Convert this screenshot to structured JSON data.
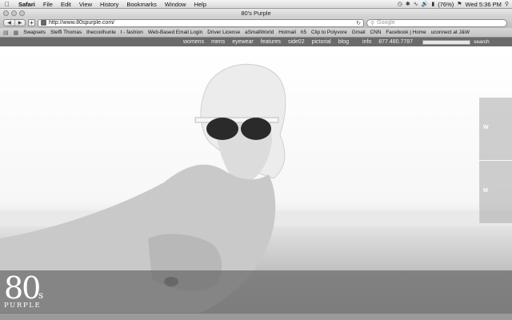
{
  "menubar": {
    "app": "Safari",
    "items": [
      "File",
      "Edit",
      "View",
      "History",
      "Bookmarks",
      "Window",
      "Help"
    ],
    "battery": "(76%)",
    "clock": "Wed 5:36 PM"
  },
  "window": {
    "title": "80's Purple"
  },
  "toolbar": {
    "url": "http://www.80spurple.com/",
    "search_placeholder": "Google"
  },
  "bookmarks": [
    "Swapsets",
    "Steffi Thomas",
    "thecoolhunte",
    "t - fashion",
    "Web-Based Email Login",
    "Driver License",
    "aSmallWorld",
    "Hotmail",
    "h5",
    "Clip to Polyvore",
    "Gmail",
    "CNN",
    "Facebook | Home",
    "uconnect at J&W"
  ],
  "sitenav": {
    "links": [
      "womens",
      "mens",
      "eyewear",
      "features",
      "side02",
      "pictorial",
      "blog",
      "info",
      "877.480.7787"
    ],
    "search_label": "search"
  },
  "sidetabs": {
    "w": "W",
    "m": "M"
  },
  "logo": {
    "number": "80",
    "s": "s",
    "word": "PURPLE"
  },
  "colors": {
    "nav_bg": "#6b6b6b",
    "footer_overlay": "#6e6e6e",
    "sidetab": "#aaaaaa"
  }
}
